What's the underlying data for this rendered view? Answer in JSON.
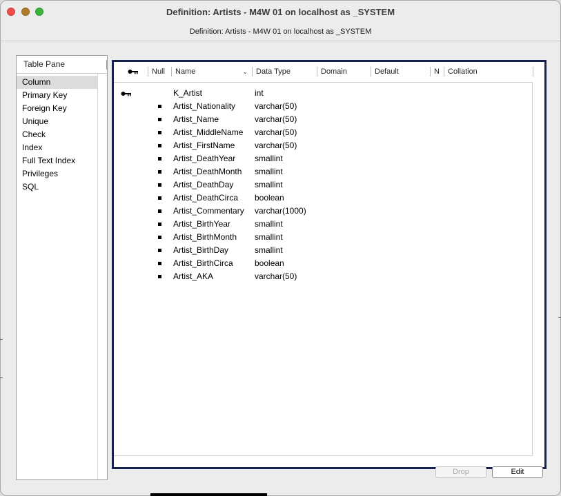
{
  "window": {
    "title": "Definition: Artists - M4W 01 on localhost as _SYSTEM",
    "subtitle": "Definition: Artists - M4W 01 on localhost as _SYSTEM"
  },
  "left_pane": {
    "header": "Table Pane",
    "items": [
      {
        "label": "Column",
        "selected": true
      },
      {
        "label": "Primary Key"
      },
      {
        "label": "Foreign Key"
      },
      {
        "label": "Unique"
      },
      {
        "label": "Check"
      },
      {
        "label": "Index"
      },
      {
        "label": "Full Text Index"
      },
      {
        "label": "Privileges"
      },
      {
        "label": "SQL"
      }
    ]
  },
  "table": {
    "columns": {
      "key_icon": "key-icon",
      "null": "Null",
      "name": "Name",
      "data_type": "Data Type",
      "domain": "Domain",
      "default": "Default",
      "n": "N",
      "collation": "Collation"
    },
    "rows": [
      {
        "key": true,
        "null_marker": false,
        "name": "K_Artist",
        "data_type": "int"
      },
      {
        "key": false,
        "null_marker": true,
        "name": "Artist_Nationality",
        "data_type": "varchar(50)"
      },
      {
        "key": false,
        "null_marker": true,
        "name": "Artist_Name",
        "data_type": "varchar(50)"
      },
      {
        "key": false,
        "null_marker": true,
        "name": "Artist_MiddleName",
        "data_type": "varchar(50)"
      },
      {
        "key": false,
        "null_marker": true,
        "name": "Artist_FirstName",
        "data_type": "varchar(50)"
      },
      {
        "key": false,
        "null_marker": true,
        "name": "Artist_DeathYear",
        "data_type": "smallint"
      },
      {
        "key": false,
        "null_marker": true,
        "name": "Artist_DeathMonth",
        "data_type": "smallint"
      },
      {
        "key": false,
        "null_marker": true,
        "name": "Artist_DeathDay",
        "data_type": "smallint"
      },
      {
        "key": false,
        "null_marker": true,
        "name": "Artist_DeathCirca",
        "data_type": "boolean"
      },
      {
        "key": false,
        "null_marker": true,
        "name": "Artist_Commentary",
        "data_type": "varchar(1000)"
      },
      {
        "key": false,
        "null_marker": true,
        "name": "Artist_BirthYear",
        "data_type": "smallint"
      },
      {
        "key": false,
        "null_marker": true,
        "name": "Artist_BirthMonth",
        "data_type": "smallint"
      },
      {
        "key": false,
        "null_marker": true,
        "name": "Artist_BirthDay",
        "data_type": "smallint"
      },
      {
        "key": false,
        "null_marker": true,
        "name": "Artist_BirthCirca",
        "data_type": "boolean"
      },
      {
        "key": false,
        "null_marker": true,
        "name": "Artist_AKA",
        "data_type": "varchar(50)"
      }
    ]
  },
  "buttons": {
    "drop": "Drop",
    "edit": "Edit"
  },
  "colors": {
    "close": "#ed4f4b",
    "minimize": "#b07a2a",
    "maximize": "#3bb33d",
    "focus_border": "#17214f"
  }
}
